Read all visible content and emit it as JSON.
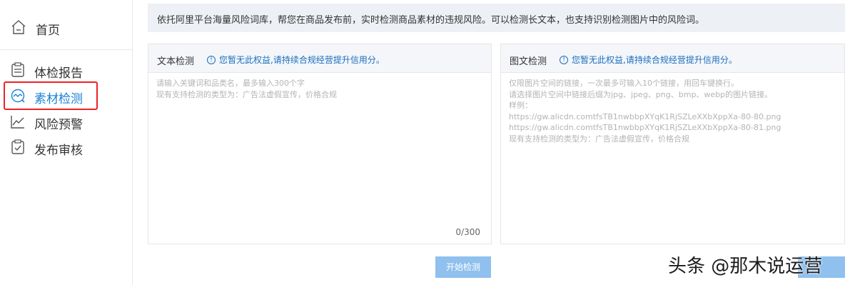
{
  "sidebar": {
    "home": {
      "label": "首页",
      "icon": "home-icon"
    },
    "items": [
      {
        "label": "体检报告",
        "icon": "report-icon",
        "active": false
      },
      {
        "label": "素材检测",
        "icon": "monitor-icon",
        "active": true
      },
      {
        "label": "风险预警",
        "icon": "trend-icon",
        "active": false
      },
      {
        "label": "发布审核",
        "icon": "clipboard-check-icon",
        "active": false
      }
    ]
  },
  "info_bar": {
    "text": "依托阿里平台海量风险词库，帮您在商品发布前，实时检测商品素材的违规风险。可以检测长文本，也支持识别检测图片中的风险词。"
  },
  "text_panel": {
    "title": "文本检测",
    "tip": "您暂无此权益,请持续合规经营提升信用分。",
    "placeholder": "请输入关键词和品类名，最多输入300个字\n现有支持检测的类型为：广告法虚假宣传，价格合规",
    "counter": "0/300"
  },
  "image_panel": {
    "title": "图文检测",
    "tip": "您暂无此权益,请持续合规经营提升信用分。",
    "placeholder": "仅限图片空间的链接，一次最多可输入10个链接，用回车键换行。\n请选择图片空间中链接后缀为jpg、jpeg、png、bmp、webp的图片链接。\n样例：\nhttps://gw.alicdn.comtfsTB1nwbbpXYqK1RjSZLeXXbXppXa-80-80.png\nhttps://gw.alicdn.comtfsTB1nwbbpXYqK1RjSZLeXXbXppXa-80-81.png\n现有支持检测的类型为：广告法虚假宣传，价格合规"
  },
  "actions": {
    "start_label": "开始检测"
  },
  "watermark": {
    "text": "头条 @那木说运营"
  },
  "colors": {
    "accent": "#1a82d8",
    "highlight_border": "#e22222",
    "button": "#8fc0ee",
    "info_bg": "#edf1f6"
  }
}
